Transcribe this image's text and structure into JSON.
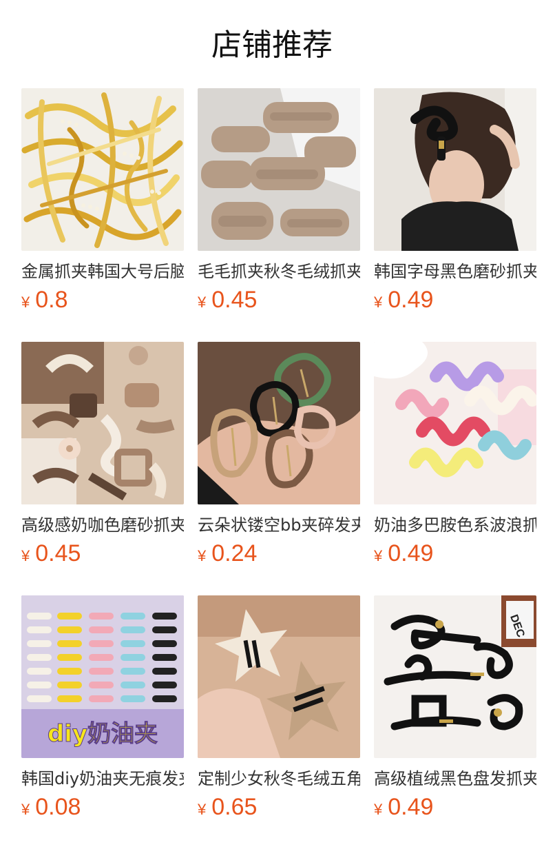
{
  "header": {
    "title": "店铺推荐"
  },
  "products": [
    {
      "name": "金属抓夹韩国大号后脑勺",
      "currency": "¥",
      "price": "0.8",
      "image_icon": "gold-metal-hair-claws-image"
    },
    {
      "name": "毛毛抓夹秋冬毛绒抓夹",
      "currency": "¥",
      "price": "0.45",
      "image_icon": "plush-hair-claws-image"
    },
    {
      "name": "韩国字母黑色磨砂抓夹",
      "currency": "¥",
      "price": "0.49",
      "image_icon": "black-matte-claw-on-hair-image"
    },
    {
      "name": "高级感奶咖色磨砂抓夹",
      "currency": "¥",
      "price": "0.45",
      "image_icon": "coffee-matte-hair-claws-image"
    },
    {
      "name": "云朵状镂空bb夹碎发夹",
      "currency": "¥",
      "price": "0.24",
      "image_icon": "cloud-bb-clips-image"
    },
    {
      "name": "奶油多巴胺色系波浪抓夹",
      "currency": "¥",
      "price": "0.49",
      "image_icon": "wave-dopamine-claws-image"
    },
    {
      "name": "韩国diy奶油夹无痕发夹",
      "currency": "¥",
      "price": "0.08",
      "image_icon": "diy-cream-clips-image",
      "image_text": "diy奶油夹"
    },
    {
      "name": "定制少女秋冬毛绒五角星",
      "currency": "¥",
      "price": "0.65",
      "image_icon": "plush-star-clips-image"
    },
    {
      "name": "高级植绒黑色盘发抓夹",
      "currency": "¥",
      "price": "0.49",
      "image_icon": "black-flocked-claws-image"
    }
  ],
  "colors": {
    "price": "#e8541c",
    "title": "#111111",
    "text": "#333333",
    "background": "#ffffff"
  }
}
